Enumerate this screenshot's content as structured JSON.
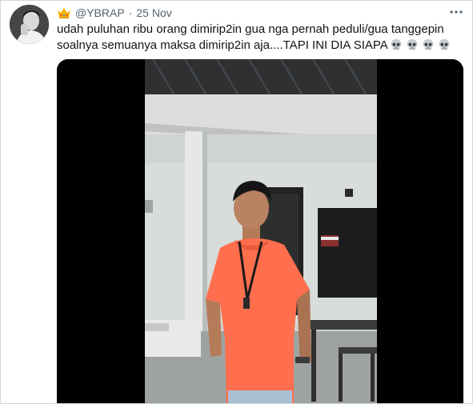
{
  "tweet": {
    "handle": "@YBRAP",
    "separator": "·",
    "date": "25 Nov",
    "text": "udah puluhan ribu orang dimirip2in gua nga pernah peduli/gua tanggepin soalnya semuanya maksa dimirip2in aja....TAPI INI DIA SIAPA",
    "emoji_icons": [
      "skull-icon",
      "skull-icon",
      "skull-icon",
      "skull-icon"
    ],
    "header_icon": "crown-icon",
    "menu_icon": "more-icon"
  },
  "colors": {
    "meta_text": "#536471",
    "main_text": "#0f1419",
    "border": "#cfd9de",
    "shirt": "#ff6f4d",
    "video_letterbox": "#000000"
  }
}
